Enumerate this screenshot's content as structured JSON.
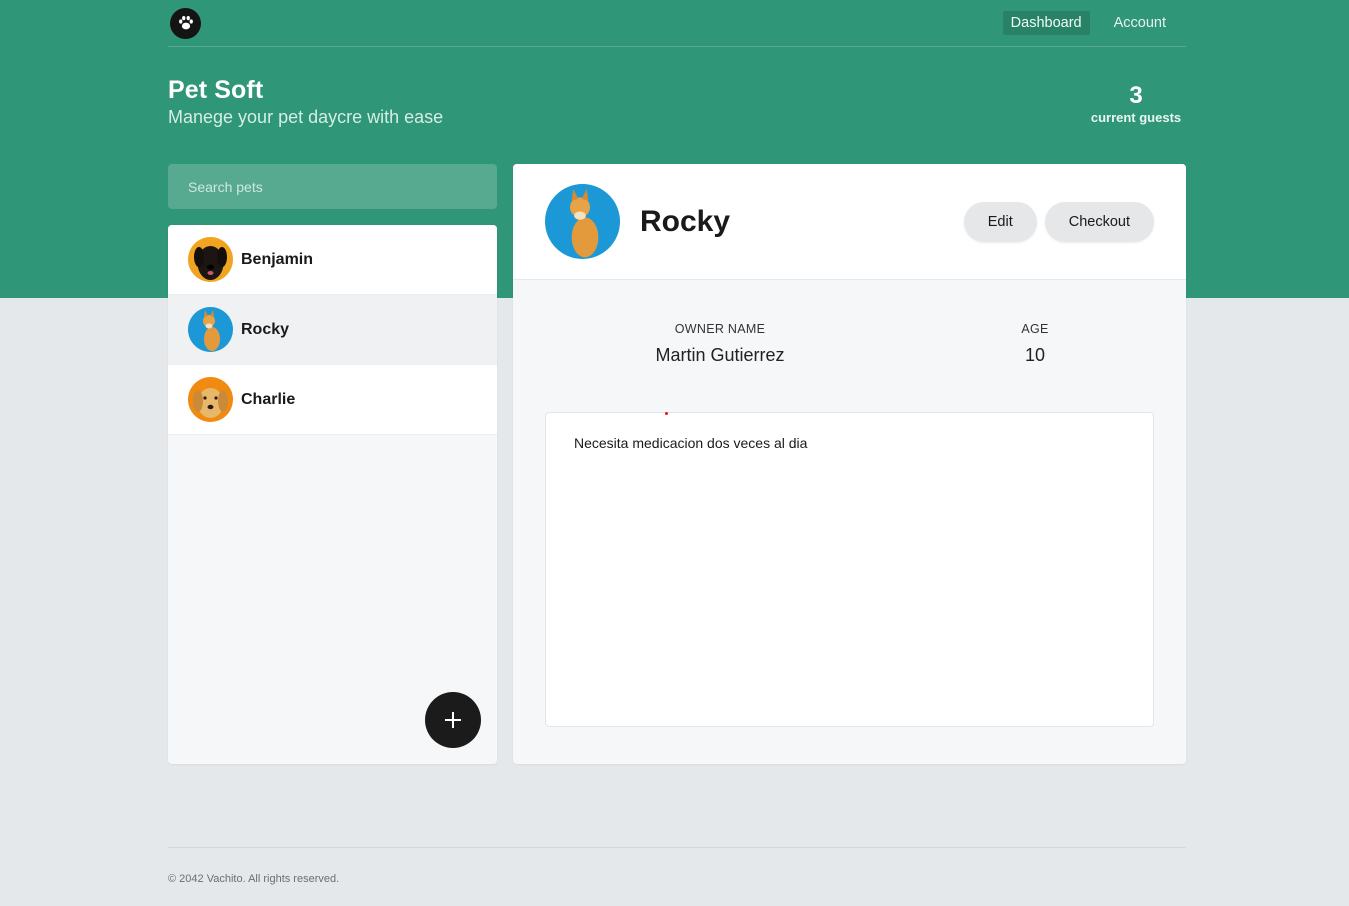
{
  "nav": {
    "logo_icon": "paw-icon",
    "links": [
      {
        "label": "Dashboard",
        "active": true
      },
      {
        "label": "Account",
        "active": false
      }
    ]
  },
  "hero": {
    "title": "Pet Soft",
    "subtitle": "Manege your pet daycre with ease",
    "guest_count": "3",
    "guest_label": "current guests"
  },
  "search": {
    "placeholder": "Search pets",
    "value": ""
  },
  "pets": [
    {
      "name": "Benjamin",
      "avatar": "black-dog-photo",
      "selected": false
    },
    {
      "name": "Rocky",
      "avatar": "shiba-dog-photo",
      "selected": true
    },
    {
      "name": "Charlie",
      "avatar": "golden-retriever-photo",
      "selected": false
    }
  ],
  "add_button_icon": "plus-icon",
  "details": {
    "name": "Rocky",
    "edit_label": "Edit",
    "checkout_label": "Checkout",
    "owner_label": "OWNER NAME",
    "owner_value": "Martin Gutierrez",
    "age_label": "AGE",
    "age_value": "10",
    "notes": "Necesita medicacion dos veces al dia"
  },
  "footer": {
    "text": "© 2042 Vachito. All rights reserved."
  },
  "colors": {
    "brand_green": "#2f9677",
    "search_bg": "#57aa8f",
    "page_bg": "#e5e8eb",
    "fab_bg": "#1b1b1b"
  }
}
